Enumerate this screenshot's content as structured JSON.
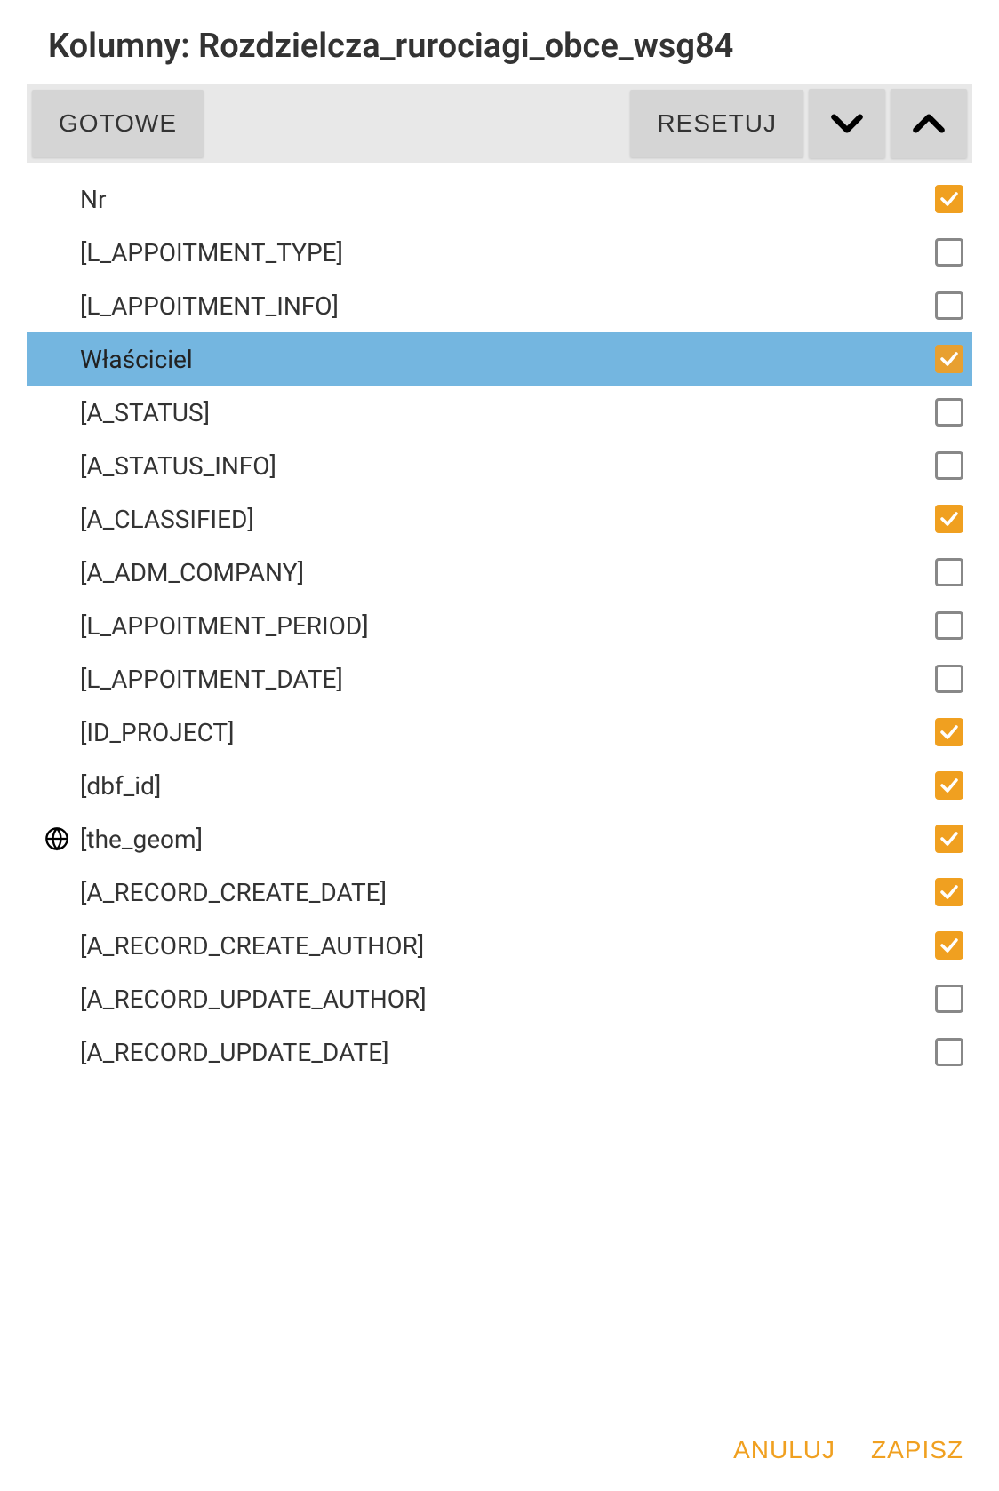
{
  "title": "Kolumny: Rozdzielcza_rurociagi_obce_wsg84",
  "toolbar": {
    "done": "GOTOWE",
    "reset": "RESETUJ"
  },
  "columns": [
    {
      "label": "Nr",
      "checked": true,
      "selected": false,
      "icon": null
    },
    {
      "label": "[L_APPOITMENT_TYPE]",
      "checked": false,
      "selected": false,
      "icon": null
    },
    {
      "label": "[L_APPOITMENT_INFO]",
      "checked": false,
      "selected": false,
      "icon": null
    },
    {
      "label": "Właściciel",
      "checked": true,
      "selected": true,
      "icon": null
    },
    {
      "label": "[A_STATUS]",
      "checked": false,
      "selected": false,
      "icon": null
    },
    {
      "label": "[A_STATUS_INFO]",
      "checked": false,
      "selected": false,
      "icon": null
    },
    {
      "label": "[A_CLASSIFIED]",
      "checked": true,
      "selected": false,
      "icon": null
    },
    {
      "label": "[A_ADM_COMPANY]",
      "checked": false,
      "selected": false,
      "icon": null
    },
    {
      "label": "[L_APPOITMENT_PERIOD]",
      "checked": false,
      "selected": false,
      "icon": null
    },
    {
      "label": "[L_APPOITMENT_DATE]",
      "checked": false,
      "selected": false,
      "icon": null
    },
    {
      "label": "[ID_PROJECT]",
      "checked": true,
      "selected": false,
      "icon": null
    },
    {
      "label": "[dbf_id]",
      "checked": true,
      "selected": false,
      "icon": null
    },
    {
      "label": "[the_geom]",
      "checked": true,
      "selected": false,
      "icon": "globe"
    },
    {
      "label": "[A_RECORD_CREATE_DATE]",
      "checked": true,
      "selected": false,
      "icon": null
    },
    {
      "label": "[A_RECORD_CREATE_AUTHOR]",
      "checked": true,
      "selected": false,
      "icon": null
    },
    {
      "label": "[A_RECORD_UPDATE_AUTHOR]",
      "checked": false,
      "selected": false,
      "icon": null
    },
    {
      "label": "[A_RECORD_UPDATE_DATE]",
      "checked": false,
      "selected": false,
      "icon": null
    }
  ],
  "footer": {
    "cancel": "ANULUJ",
    "save": "ZAPISZ"
  }
}
